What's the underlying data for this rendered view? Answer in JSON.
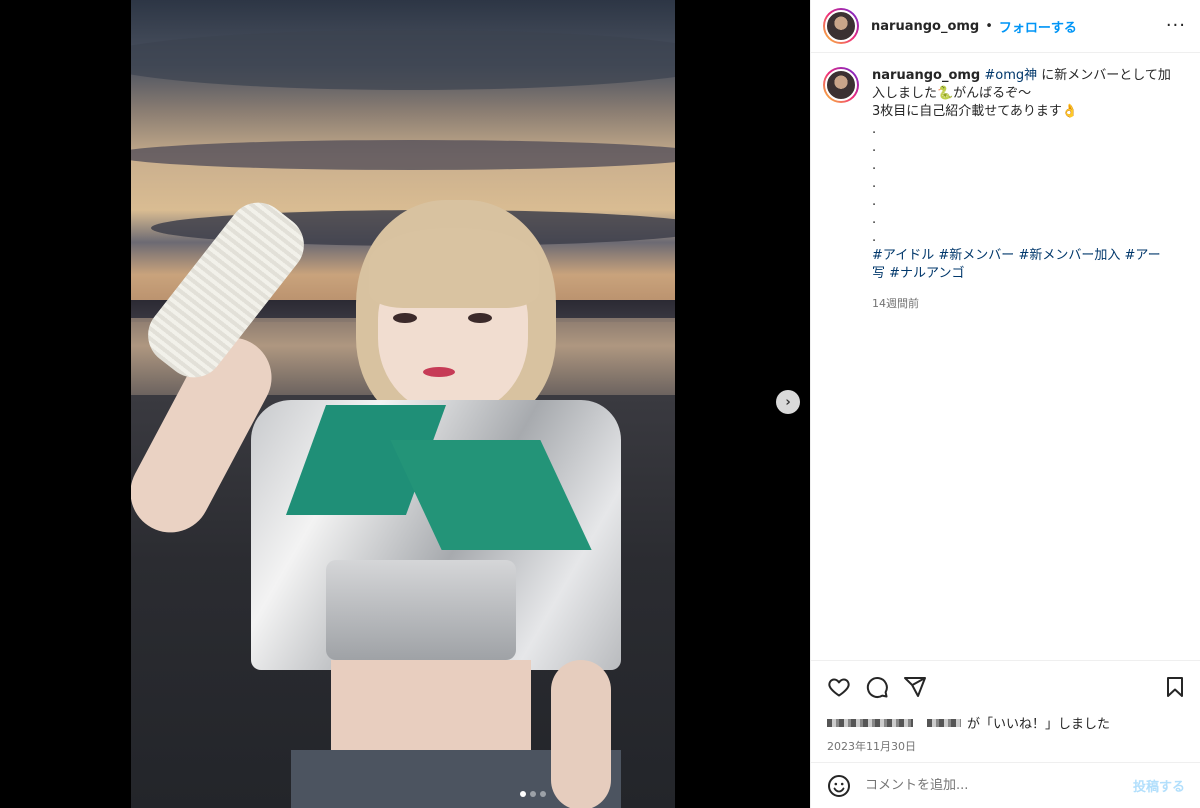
{
  "post": {
    "image_alt": "",
    "carousel": {
      "count": 3,
      "active_index": 0
    }
  },
  "header": {
    "username": "naruango_omg",
    "separator": "•",
    "follow_label": "フォローする",
    "more_label": "···"
  },
  "caption": {
    "username": "naruango_omg",
    "tag_omg": "#omg神",
    "line1_rest": "に新メンバーとして加入しました🐍がんばるぞ〜",
    "line2": "3枚目に自己紹介載せてあります👌",
    "dots": [
      ".",
      ".",
      ".",
      ".",
      ".",
      ".",
      "."
    ],
    "hashtags": [
      "#アイドル",
      "#新メンバー",
      "#新メンバー加入",
      "#アー写",
      "#ナルアンゴ"
    ],
    "time_ago": "14週間前"
  },
  "actions": {
    "liked_by_suffix": "が「いいね！」しました",
    "date": "2023年11月30日"
  },
  "comment": {
    "placeholder": "コメントを追加...",
    "post_label": "投稿する"
  },
  "next_button": "›"
}
